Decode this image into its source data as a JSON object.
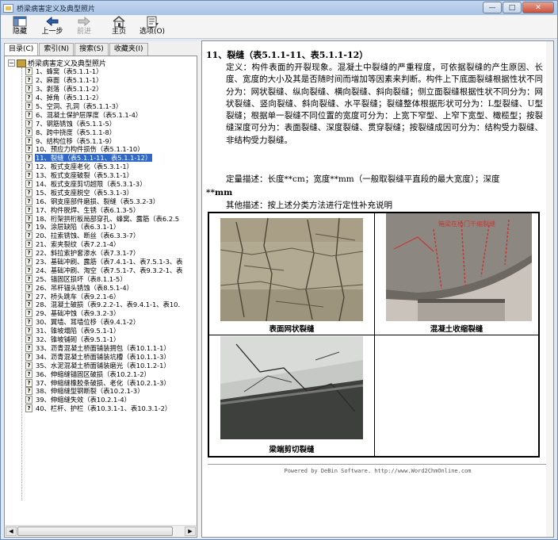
{
  "window": {
    "title": "桥梁病害定义及典型照片",
    "controls": {
      "minimize": "—",
      "maximize": "□",
      "close": "✕"
    }
  },
  "toolbar": {
    "hide": "隐藏",
    "back": "上一步",
    "forward": "前进",
    "home": "主页",
    "options": "选项(O)"
  },
  "nav_tabs": [
    "目录(C)",
    "索引(N)",
    "搜索(S)",
    "收藏夹(I)"
  ],
  "tree": {
    "root": "桥梁病害定义及典型照片",
    "items": [
      "1、蜂窝（表5.1.1-1）",
      "2、麻面（表5.1.1-1）",
      "3、剥落（表5.1.1-2）",
      "4、掉角（表5.1.1-2）",
      "5、空洞、孔洞（表5.1.1-3）",
      "6、混凝土保护层厚度（表5.1.1-4）",
      "7、钢筋锈蚀（表5.1.1-5）",
      "8、跨中挠度（表5.1.1-8）",
      "9、结构位移（表5.1.1-9）",
      "10、预应力构件损伤（表5.1.1-10）",
      "11、裂缝（表5.1.1-11、表5.1.1-12）",
      "12、板式支座老化（表5.3.1-1）",
      "13、板式支座破裂（表5.3.1-1）",
      "14、板式支座剪切超限（表5.3.1-3）",
      "15、板式支座脱空（表5.3.1-3）",
      "16、钢支座部件磨损、裂缝（表5.3.2-3）",
      "17、构件脱焊、生锈（表6.1.3-5）",
      "18、桁架拱桁板局部穿孔、蜂窝、露筋（表6.2.5",
      "19、涂层缺陷（表6.3.1-1）",
      "20、拉索锈蚀、断丝（表6.3.3-7）",
      "21、索夹裂纹（表7.2.1-4）",
      "22、斜拉索护套渗水（表7.3.1-7）",
      "23、基础冲刷、露筋（表7.4.1-1、表7.5.1-3、表",
      "24、基础冲刷、淘空（表7.5.1-7、表9.3.2-1、表",
      "25、锚固区损坏（表8.1.1-5）",
      "26、吊杆锚头锈蚀（表8.5.1-4）",
      "27、桥头跳车（表9.2.1-6）",
      "28、混凝土破损（表9.2.2-1、表9.4.1-1、表10.",
      "29、基础冲蚀（表9.3.2-3）",
      "30、翼墙、耳墙位移（表9.4.1-2）",
      "31、锥坡塌陷（表9.5.1-1）",
      "32、锥坡铺砌（表9.5.1-1）",
      "33、沥青混凝土桥面铺装拥包（表10.1.1-1）",
      "34、沥青混凝土桥面铺装坑槽（表10.1.1-3）",
      "35、水泥混凝土桥面铺装磨光（表10.1.2-1）",
      "36、伸缩缝锚固区破损（表10.2.1-2）",
      "37、伸缩缝橡胶条破损、老化（表10.2.1-3）",
      "38、伸缩缝型钢断裂（表10.2.1-3）",
      "39、伸缩缝失效（表10.2.1-4）",
      "40、栏杆、护栏（表10.3.1-1、表10.3.1-2）"
    ],
    "selected_index": 10
  },
  "article": {
    "heading": "11、裂缝（表5.1.1-11、表5.1.1-12）",
    "definition": "定义：构件表面的开裂现象。混凝土中裂缝的严重程度，可依据裂缝的产生原因、长度、宽度的大小及其是否随时间而增加等因素来判断。构件上下底面裂缝根据性状不同分为：网状裂缝、纵向裂缝、横向裂缝、斜向裂缝；侧立面裂缝根据性状不同分为：网状裂缝、竖向裂缝、斜向裂缝、水平裂缝；裂缝整体根据形状可分为：L型裂缝、U型裂缝；根据单一裂缝不同位置的宽度可分为：上宽下窄型、上窄下宽型、橄榄型；按裂缝深度可分为：表面裂缝、深度裂缝、贯穿裂缝；按裂缝成因可分为：结构受力裂缝、非结构受力裂缝。",
    "quant_line1": "定量描述：长度**cm；宽度**mm（一般取裂缝平直段的最大宽度）；深度",
    "quant_line2": "**mm",
    "other": "其他描述：按上述分类方法进行定性补充说明",
    "photos": [
      {
        "caption": "表面网状裂缝"
      },
      {
        "caption": "混凝土收缩裂缝",
        "overlay_text": "箱梁在桥门干缩裂缝"
      },
      {
        "caption": "梁端剪切裂缝"
      },
      {
        "caption": ""
      }
    ]
  },
  "footer": "Powered by DeBin Software.  http://www.Word2ChmOnline.com"
}
